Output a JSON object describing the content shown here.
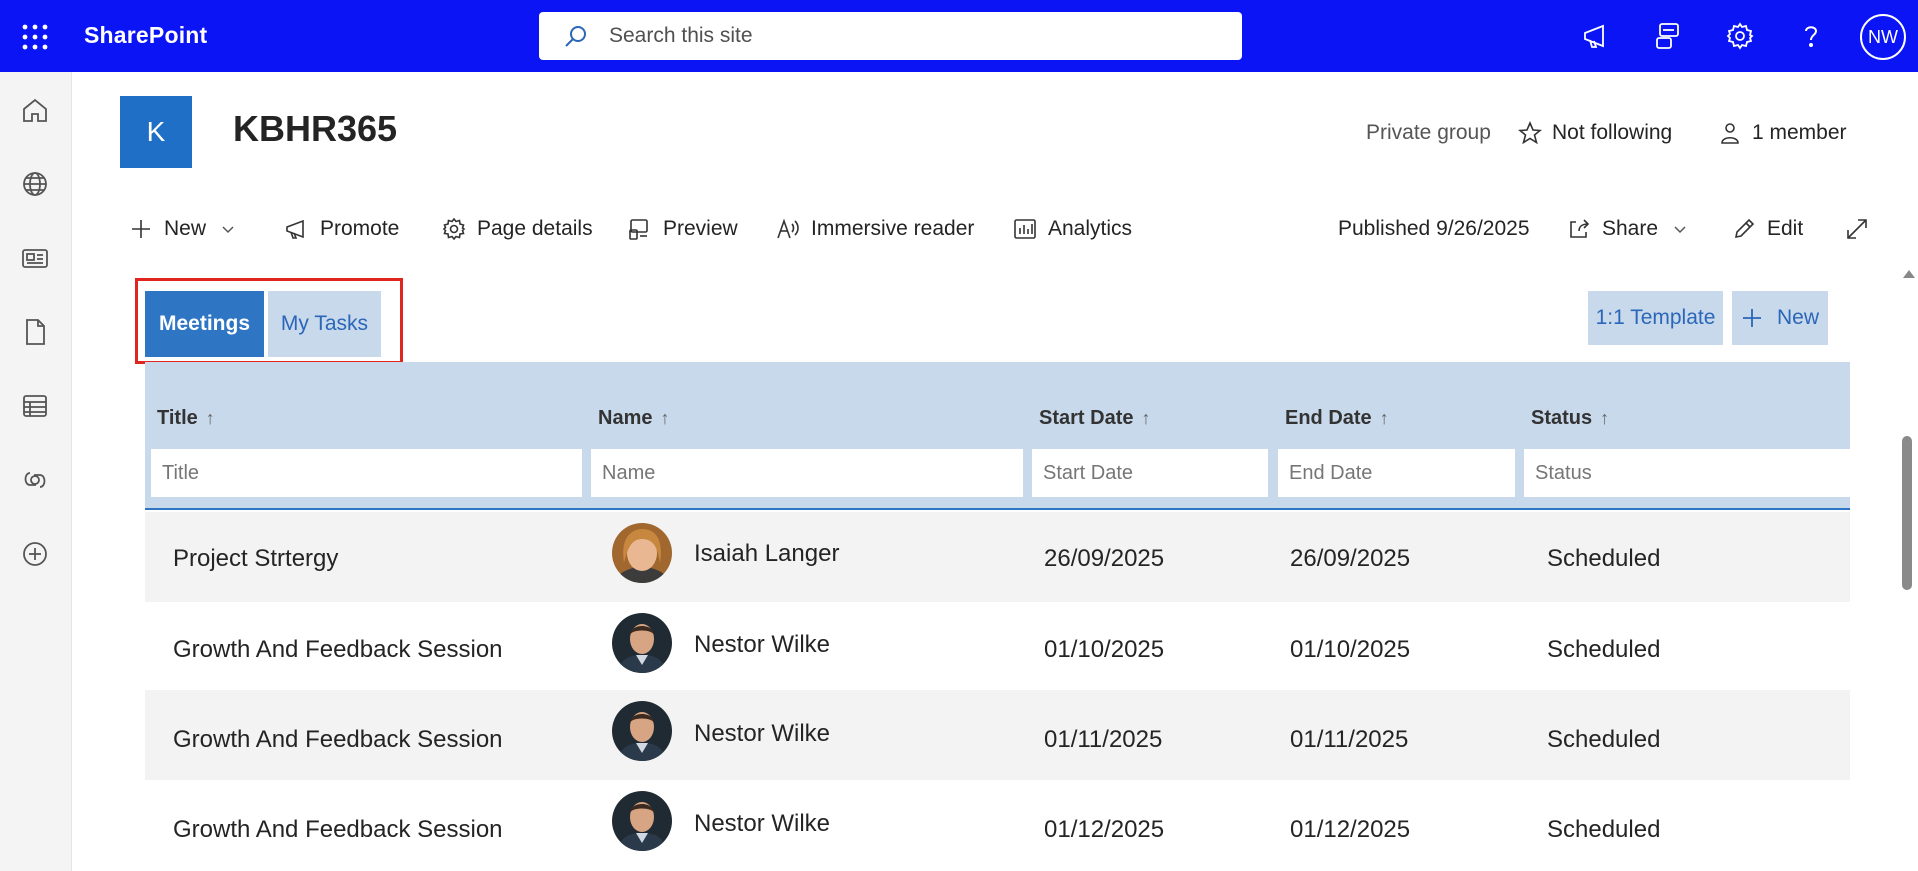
{
  "suitebar": {
    "brand": "SharePoint",
    "search_placeholder": "Search this site",
    "avatar_initials": "NW",
    "bg_color": "#0a14f5"
  },
  "site": {
    "logo_letter": "K",
    "title": "KBHR365",
    "privacy": "Private group",
    "follow": "Not following",
    "members": "1 member"
  },
  "commandbar": {
    "new": "New",
    "promote": "Promote",
    "page_details": "Page details",
    "preview": "Preview",
    "immersive_reader": "Immersive reader",
    "analytics": "Analytics",
    "published": "Published 9/26/2025",
    "share": "Share",
    "edit": "Edit"
  },
  "tabs": {
    "meetings": "Meetings",
    "my_tasks": "My Tasks",
    "template_button": "1:1 Template",
    "new_button": "New"
  },
  "table": {
    "columns": [
      {
        "label": "Title",
        "filter_placeholder": "Title"
      },
      {
        "label": "Name",
        "filter_placeholder": "Name"
      },
      {
        "label": "Start Date",
        "filter_placeholder": "Start Date"
      },
      {
        "label": "End Date",
        "filter_placeholder": "End Date"
      },
      {
        "label": "Status",
        "filter_placeholder": "Status"
      }
    ],
    "sort_arrow": "↑",
    "rows": [
      {
        "title": "Project Strtergy",
        "name": "Isaiah Langer",
        "start": "26/09/2025",
        "end": "26/09/2025",
        "status": "Scheduled"
      },
      {
        "title": "Growth And Feedback Session",
        "name": "Nestor Wilke",
        "start": "01/10/2025",
        "end": "01/10/2025",
        "status": "Scheduled"
      },
      {
        "title": "Growth And Feedback Session",
        "name": "Nestor Wilke",
        "start": "01/11/2025",
        "end": "01/11/2025",
        "status": "Scheduled"
      },
      {
        "title": "Growth And Feedback Session",
        "name": "Nestor Wilke",
        "start": "01/12/2025",
        "end": "01/12/2025",
        "status": "Scheduled"
      }
    ]
  }
}
